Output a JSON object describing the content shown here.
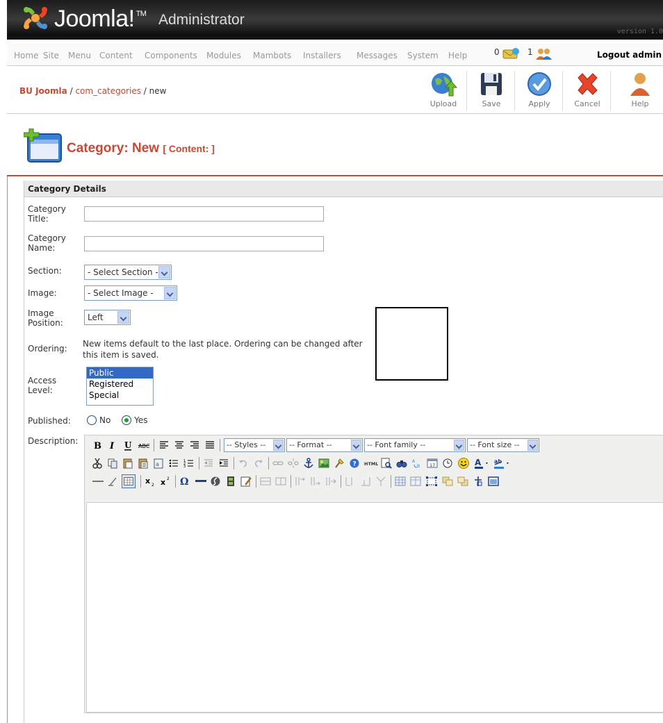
{
  "header": {
    "logo_text": "Joomla!",
    "logo_tm": "TM",
    "product": "Administrator",
    "version": "version 1.0"
  },
  "menu": {
    "items": [
      "Home",
      "Site",
      "Menu",
      "Content",
      "Components",
      "Modules",
      "Mambots",
      "Installers",
      "Messages",
      "System",
      "Help"
    ],
    "messages_count": "0",
    "users_count": "1",
    "logout": "Logout admin"
  },
  "breadcrumb": {
    "root": "BU Joomla",
    "component": "com_categories",
    "task": "new"
  },
  "toolbar": {
    "upload": "Upload",
    "save": "Save",
    "apply": "Apply",
    "cancel": "Cancel",
    "help": "Help"
  },
  "page": {
    "title": "Category: New",
    "subtitle": "[ Content: ]"
  },
  "form": {
    "section_header": "Category Details",
    "title_label_1": "Category",
    "title_label_2": "Title:",
    "name_label_1": "Category",
    "name_label_2": "Name:",
    "section_label": "Section:",
    "section_value": "- Select Section -",
    "image_label": "Image:",
    "image_value": "- Select Image -",
    "position_label_1": "Image",
    "position_label_2": "Position:",
    "position_value": "Left",
    "ordering_label": "Ordering:",
    "ordering_note": "New items default to the last place. Ordering can be changed after this item is saved.",
    "access_label_1": "Access",
    "access_label_2": "Level:",
    "access_options": [
      "Public",
      "Registered",
      "Special"
    ],
    "published_label": "Published:",
    "published_no": "No",
    "published_yes": "Yes",
    "description_label": "Description:"
  },
  "editor": {
    "styles": "-- Styles --",
    "format": "-- Format --",
    "font_family": "-- Font family --",
    "font_size": "-- Font size --"
  }
}
